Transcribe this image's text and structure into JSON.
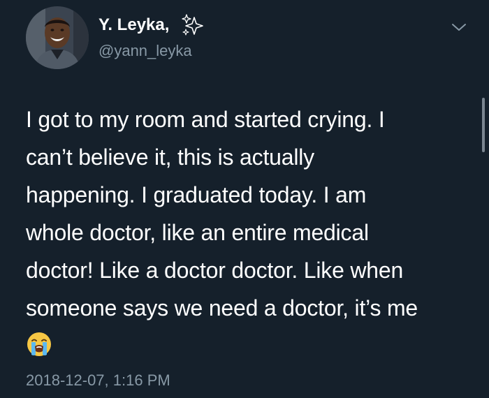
{
  "author": {
    "display_name": "Y. Leyka,",
    "handle": "@yann_leyka",
    "name_emoji_icon": "sparkles-icon",
    "avatar_icon": "avatar"
  },
  "tweet": {
    "text_lines": [
      "I got to my room and started crying. I",
      "can’t believe it, this is actually",
      "happening. I graduated today. I am",
      "whole doctor, like an entire medical",
      "doctor! Like a doctor doctor. Like when",
      "someone says we need a doctor, it’s me"
    ],
    "trailing_emoji_icon": "loudly-crying-face-icon",
    "timestamp": "2018-12-07, 1:16 PM"
  },
  "menu": {
    "icon": "chevron-down-icon"
  },
  "colors": {
    "background": "#15202b",
    "text": "#ffffff",
    "secondary_text": "#8899a6"
  }
}
